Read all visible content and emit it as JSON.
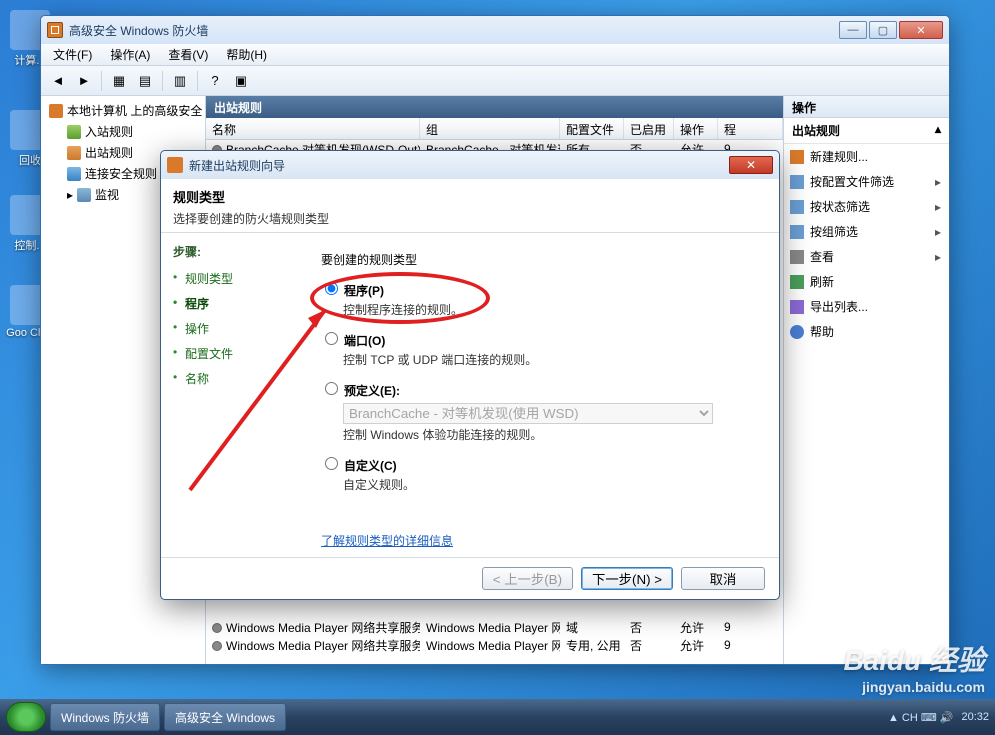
{
  "desktop": {
    "i1": "计算...",
    "i2": "回收",
    "i3": "控制...",
    "i4": "Goo\nChro"
  },
  "window": {
    "title": "高级安全 Windows 防火墙",
    "menu": {
      "file": "文件(F)",
      "action": "操作(A)",
      "view": "查看(V)",
      "help": "帮助(H)"
    },
    "tree": {
      "root": "本地计算机 上的高级安全 Win",
      "in": "入站规则",
      "out": "出站规则",
      "sec": "连接安全规则",
      "mon": "监视"
    },
    "center_title": "出站规则",
    "cols": {
      "name": "名称",
      "grp": "组",
      "prof": "配置文件",
      "en": "已启用",
      "act": "操作",
      "rest": "程"
    },
    "rows": [
      {
        "name": "BranchCache 对等机发现(WSD-Out)",
        "grp": "BranchCache - 对等机发现...",
        "prof": "所有",
        "en": "否",
        "act": "允许",
        "dot": "grey"
      },
      {
        "name": "Windows Media Player 网络共享服务...",
        "grp": "Windows Media Player 网...",
        "prof": "域",
        "en": "否",
        "act": "允许",
        "dot": "grey"
      },
      {
        "name": "Windows Media Player 网络共享服务...",
        "grp": "Windows Media Player 网...",
        "prof": "专用, 公用",
        "en": "否",
        "act": "允许",
        "dot": "grey"
      }
    ],
    "actions": {
      "hdr": "操作",
      "sub": "出站规则",
      "items": [
        {
          "l": "新建规则...",
          "ic": "ai-new",
          "chev": false
        },
        {
          "l": "按配置文件筛选",
          "ic": "ai-filter",
          "chev": true
        },
        {
          "l": "按状态筛选",
          "ic": "ai-filter",
          "chev": true
        },
        {
          "l": "按组筛选",
          "ic": "ai-filter",
          "chev": true
        },
        {
          "l": "查看",
          "ic": "ai-view",
          "chev": true
        },
        {
          "l": "刷新",
          "ic": "ai-refresh",
          "chev": false
        },
        {
          "l": "导出列表...",
          "ic": "ai-export",
          "chev": false
        },
        {
          "l": "帮助",
          "ic": "ai-help",
          "chev": false
        }
      ]
    }
  },
  "wizard": {
    "title": "新建出站规则向导",
    "h": "规则类型",
    "hsub": "选择要创建的防火墙规则类型",
    "steps_lbl": "步骤:",
    "steps": [
      "规则类型",
      "程序",
      "操作",
      "配置文件",
      "名称"
    ],
    "cur_step": 1,
    "question": "要创建的规则类型",
    "opt1": {
      "l": "程序(P)",
      "d": "控制程序连接的规则。"
    },
    "opt2": {
      "l": "端口(O)",
      "d": "控制 TCP 或 UDP 端口连接的规则。"
    },
    "opt3": {
      "l": "预定义(E):",
      "sel": "BranchCache - 对等机发现(使用 WSD)",
      "d": "控制 Windows 体验功能连接的规则。"
    },
    "opt4": {
      "l": "自定义(C)",
      "d": "自定义规则。"
    },
    "learn": "了解规则类型的详细信息",
    "back": "< 上一步(B)",
    "next": "下一步(N) >",
    "cancel": "取消"
  },
  "taskbar": {
    "t1": "Windows 防火墙",
    "t2": "高级安全 Windows",
    "time": "20:32"
  },
  "watermark": {
    "brand": "Baidu 经验",
    "url": "jingyan.baidu.com"
  }
}
